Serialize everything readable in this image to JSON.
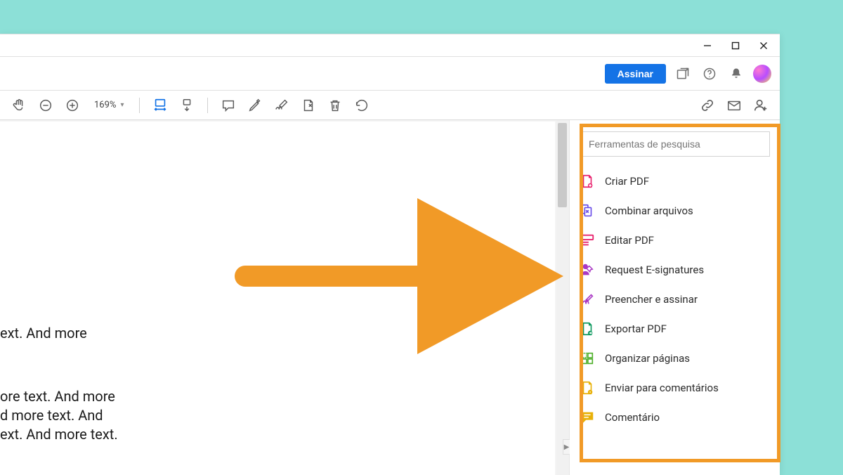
{
  "window_controls": {
    "min": "–",
    "max": "❐",
    "close": "✕"
  },
  "topbar": {
    "assinar": "Assinar"
  },
  "toolbar": {
    "zoom_value": "169%"
  },
  "document": {
    "line1": "ext. And more",
    "line2": "ore text. And more",
    "line3": "d more text. And",
    "line4": "ext. And more text."
  },
  "right_panel": {
    "search_placeholder": "Ferramentas de pesquisa",
    "tools": [
      {
        "key": "criar",
        "label": "Criar PDF"
      },
      {
        "key": "combinar",
        "label": "Combinar arquivos"
      },
      {
        "key": "editar",
        "label": "Editar PDF"
      },
      {
        "key": "esign",
        "label": "Request E-signatures"
      },
      {
        "key": "preencher",
        "label": "Preencher e assinar"
      },
      {
        "key": "exportar",
        "label": "Exportar PDF"
      },
      {
        "key": "organizar",
        "label": "Organizar páginas"
      },
      {
        "key": "enviar",
        "label": "Enviar para comentários"
      },
      {
        "key": "comentario",
        "label": "Comentário"
      }
    ]
  },
  "colors": {
    "accent": "#1473e6",
    "highlight": "#f19a27",
    "bg": "#8ce0d7"
  }
}
